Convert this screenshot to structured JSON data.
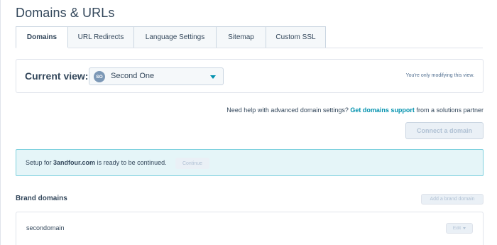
{
  "page": {
    "title": "Domains & URLs"
  },
  "tabs": [
    {
      "label": "Domains"
    },
    {
      "label": "URL Redirects"
    },
    {
      "label": "Language Settings"
    },
    {
      "label": "Sitemap"
    },
    {
      "label": "Custom SSL"
    }
  ],
  "current_view": {
    "label": "Current view:",
    "avatar_initials": "SO",
    "selected": "Second One",
    "note": "You're only modifying this view."
  },
  "help": {
    "prefix": "Need help with advanced domain settings?",
    "link": "Get domains support",
    "suffix": "from a solutions partner"
  },
  "connect_button": "Connect a domain",
  "setup_banner": {
    "prefix": "Setup for",
    "domain": "3andfour.com",
    "suffix": "is ready to be continued.",
    "button": "Continue"
  },
  "brand_domains": {
    "title": "Brand domains",
    "add_button": "Add a brand domain",
    "items": [
      {
        "name": "secondomain",
        "action": "Edit"
      }
    ]
  },
  "colors": {
    "text": "#33475b",
    "link": "#0091ae",
    "banner_bg": "#e5f5f8",
    "banner_border": "#7fd1de",
    "disabled_text": "#b0c1d4"
  }
}
